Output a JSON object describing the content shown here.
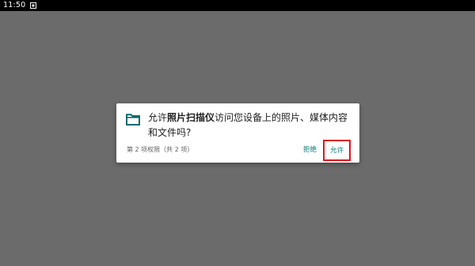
{
  "status_bar": {
    "time": "11:50",
    "notification_icon": "screenshot-notification-icon"
  },
  "dialog": {
    "icon": "folder-icon",
    "message_prefix": "允许",
    "app_name": "照片扫描仪",
    "message_suffix": "访问您设备上的照片、媒体内容和文件吗?",
    "counter": "第 2 项权限（共 2 项）",
    "deny_label": "拒绝",
    "allow_label": "允许"
  },
  "colors": {
    "background": "#6b6b6b",
    "accent": "#007a78",
    "highlight_box": "#e0141c"
  }
}
